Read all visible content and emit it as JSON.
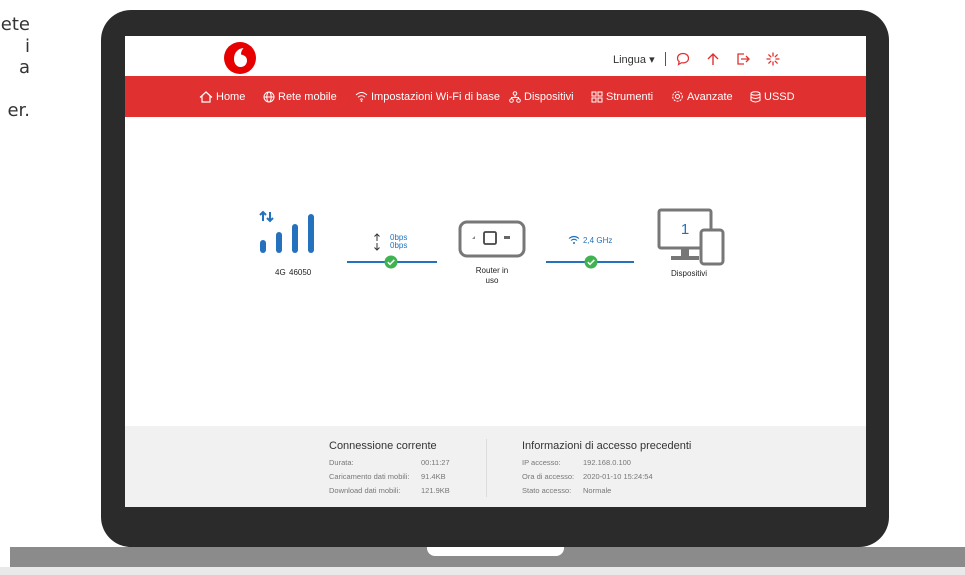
{
  "side_text": [
    "ete",
    "i",
    "a",
    "",
    "er."
  ],
  "header": {
    "language_label": "Lingua ▾"
  },
  "nav": {
    "items": [
      {
        "label": "Home"
      },
      {
        "label": "Rete mobile"
      },
      {
        "label": "Impostazioni Wi-Fi di base"
      },
      {
        "label": "Dispositivi"
      },
      {
        "label": "Strumenti"
      },
      {
        "label": "Avanzate"
      },
      {
        "label": "USSD"
      }
    ]
  },
  "status": {
    "network_type": "4G",
    "operator_code": "46050",
    "upload_speed": "0bps",
    "download_speed": "0bps",
    "router_label": "Router in uso",
    "wifi_band": "2,4 GHz",
    "devices_count": "1",
    "devices_label": "Dispositivi"
  },
  "colors": {
    "accent_red": "#e03030",
    "link_blue": "#2472bd",
    "ok_green": "#3fb34f"
  },
  "current_connection": {
    "title": "Connessione corrente",
    "rows": [
      {
        "label": "Durata:",
        "value": "00:11:27"
      },
      {
        "label": "Caricamento dati mobili:",
        "value": "91.4KB"
      },
      {
        "label": "Download dati mobili:",
        "value": "121.9KB"
      }
    ]
  },
  "previous_access": {
    "title": "Informazioni di accesso precedenti",
    "rows": [
      {
        "label": "IP accesso:",
        "value": "192.168.0.100"
      },
      {
        "label": "Ora di accesso:",
        "value": "2020-01-10 15:24:54"
      },
      {
        "label": "Stato accesso:",
        "value": "Normale"
      }
    ]
  }
}
